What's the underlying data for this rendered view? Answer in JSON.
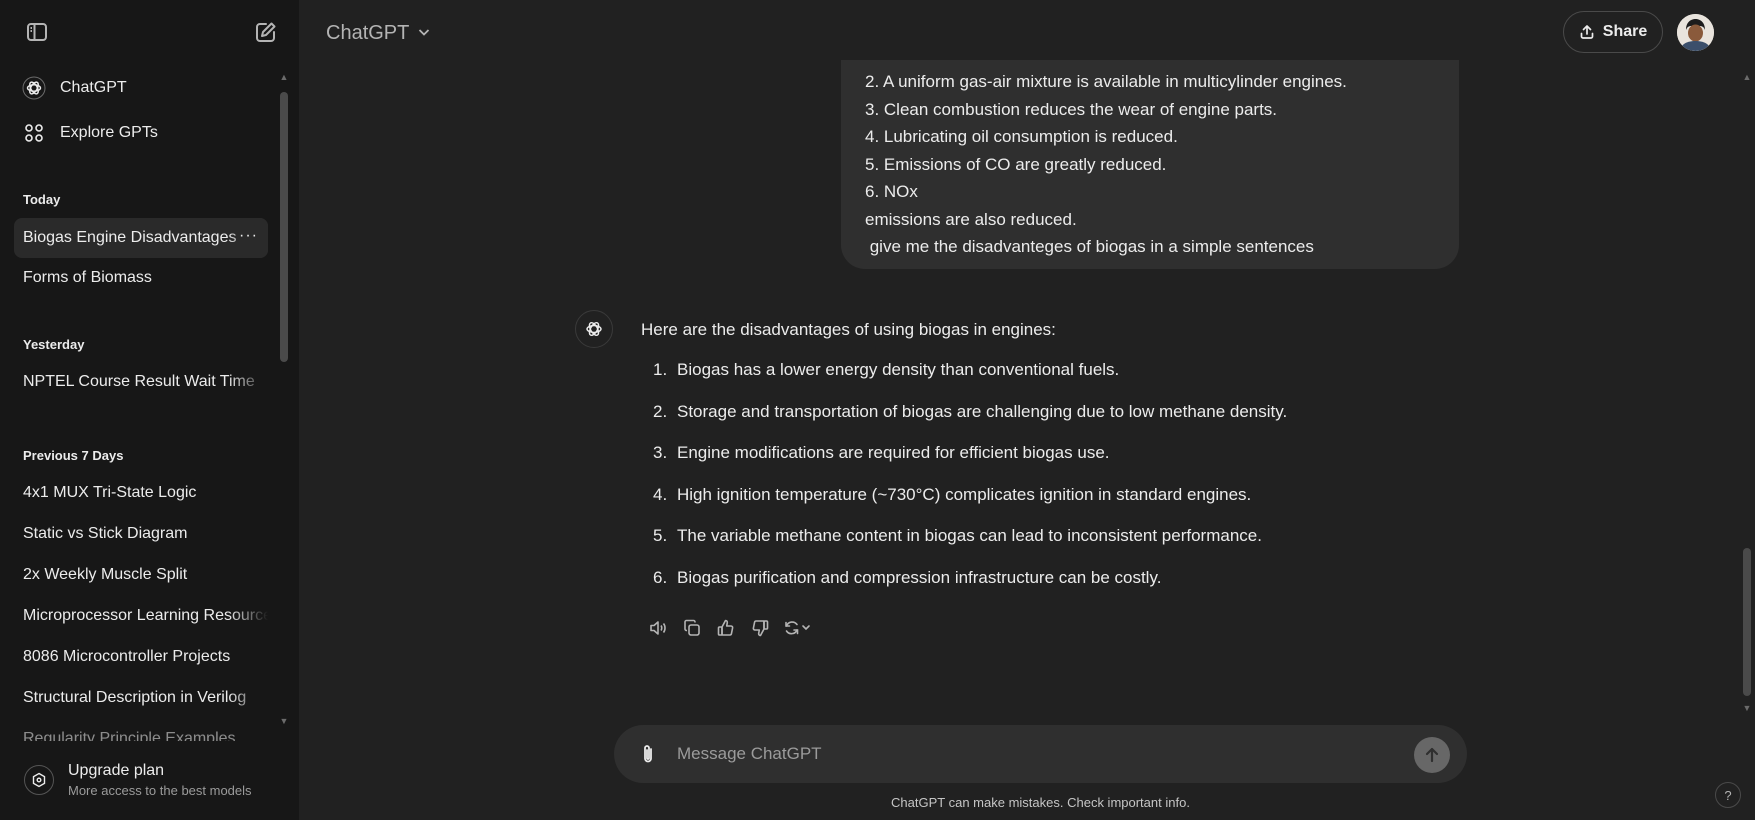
{
  "header": {
    "model_label": "ChatGPT",
    "share_label": "Share"
  },
  "sidebar": {
    "nav": [
      {
        "label": "ChatGPT",
        "icon": "openai-logo-icon"
      },
      {
        "label": "Explore GPTs",
        "icon": "grid-icon"
      }
    ],
    "sections": [
      {
        "title": "Today",
        "items": [
          "Biogas Engine Disadvantages",
          "Forms of Biomass"
        ]
      },
      {
        "title": "Yesterday",
        "items": [
          "NPTEL Course Result Wait Time"
        ]
      },
      {
        "title": "Previous 7 Days",
        "items": [
          "4x1 MUX Tri-State Logic",
          "Static vs Stick Diagram",
          "2x Weekly Muscle Split",
          "Microprocessor Learning Resources",
          "8086 Microcontroller Projects",
          "Structural Description in Verilog",
          "Regularity Principle Examples"
        ]
      }
    ],
    "item_options": "···",
    "upgrade": {
      "title": "Upgrade plan",
      "subtitle": "More access to the best models"
    }
  },
  "conversation": {
    "user_message_lines": [
      "2. A uniform gas-air mixture is available in multicylinder engines.",
      "3. Clean combustion reduces the wear of engine parts.",
      "4. Lubricating oil consumption is reduced.",
      "5. Emissions of CO are greatly reduced.",
      "6. NOx",
      "emissions are also reduced.",
      " give me the disadvanteges of biogas in a simple sentences"
    ],
    "assistant_intro": "Here are the disadvantages of using biogas in engines:",
    "assistant_points": [
      {
        "num": "1.",
        "text": "Biogas has a lower energy density than conventional fuels."
      },
      {
        "num": "2.",
        "text": "Storage and transportation of biogas are challenging due to low methane density."
      },
      {
        "num": "3.",
        "text": "Engine modifications are required for efficient biogas use."
      },
      {
        "num": "4.",
        "text": "High ignition temperature (~730°C) complicates ignition in standard engines."
      },
      {
        "num": "5.",
        "text": "The variable methane content in biogas can lead to inconsistent performance."
      },
      {
        "num": "6.",
        "text": "Biogas purification and compression infrastructure can be costly."
      }
    ]
  },
  "composer": {
    "placeholder": "Message ChatGPT",
    "disclaimer": "ChatGPT can make mistakes. Check important info."
  },
  "help_label": "?",
  "colors": {
    "background": "#212121",
    "sidebar": "#171717",
    "bubble": "#2f2f2f",
    "text": "#ececec",
    "muted": "#9b9b9b"
  }
}
